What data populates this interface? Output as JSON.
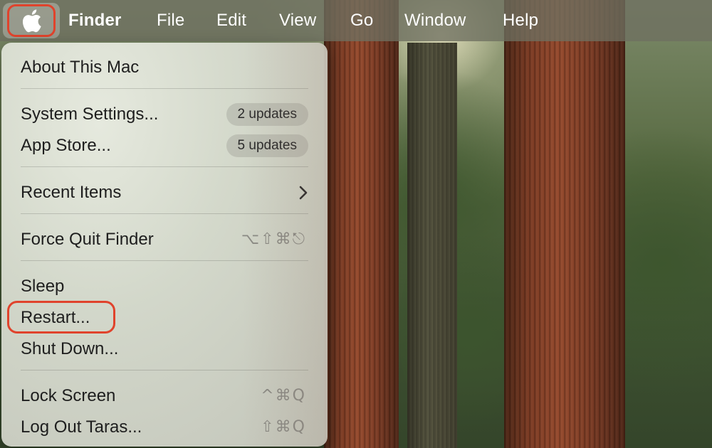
{
  "menubar": {
    "apple_icon": "apple-logo-icon",
    "items": [
      "Finder",
      "File",
      "Edit",
      "View",
      "Go",
      "Window",
      "Help"
    ]
  },
  "apple_menu": {
    "items": [
      {
        "label": "About This Mac"
      },
      {
        "label": "System Settings...",
        "badge": "2 updates"
      },
      {
        "label": "App Store...",
        "badge": "5 updates"
      },
      {
        "label": "Recent Items",
        "submenu_icon": "chevron-right-icon"
      },
      {
        "label": "Force Quit Finder",
        "shortcut": "⌥⇧⌘⎋"
      },
      {
        "label": "Sleep"
      },
      {
        "label": "Restart..."
      },
      {
        "label": "Shut Down..."
      },
      {
        "label": "Lock Screen",
        "shortcut": "^⌘Q"
      },
      {
        "label": "Log Out Taras...",
        "shortcut": "⇧⌘Q"
      }
    ]
  },
  "highlight_color": "#e0432c"
}
